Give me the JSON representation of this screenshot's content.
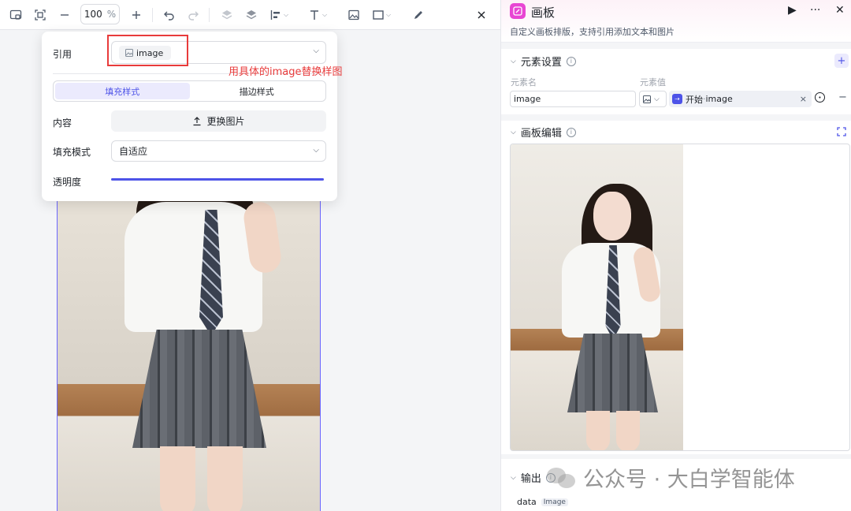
{
  "toolbar": {
    "zoom_value": "100",
    "zoom_unit": "%",
    "items": [
      "canvas-fit-icon",
      "fullscreen-icon",
      "zoom-out-icon",
      "zoom-in-icon",
      "undo-icon",
      "redo-icon",
      "layer-up-icon",
      "layer-down-icon",
      "align-icon",
      "text-icon",
      "image-icon",
      "rect-icon",
      "pen-icon",
      "close-icon"
    ]
  },
  "props_panel": {
    "ref_label": "引用",
    "ref_chip": "image",
    "annotation": "用具体的image替换样图",
    "tab_fill": "填充样式",
    "tab_stroke": "描边样式",
    "content_label": "内容",
    "replace_button": "更换图片",
    "fill_mode_label": "填充模式",
    "fill_mode_value": "自适应",
    "opacity_label": "透明度",
    "opacity": 1.0
  },
  "right_panel": {
    "title": "画板",
    "subtitle": "自定义画板排版，支持引用添加文本和图片",
    "element_settings": {
      "title": "元素设置",
      "col_name": "元素名",
      "col_value": "元素值",
      "name_value": "image",
      "value_prefix": "开始",
      "value_sep": " · ",
      "value_ref": "image",
      "add_label": "+",
      "remove_label": "−"
    },
    "canvas_edit": {
      "title": "画板编辑"
    },
    "output": {
      "title": "输出",
      "var_name": "data",
      "var_type": "Image"
    }
  },
  "watermark": {
    "text": "公众号 · 大白学智能体"
  },
  "colors": {
    "accent": "#4d53e8",
    "annotation_red": "#e83b3b",
    "app_icon": "#e846d3"
  }
}
